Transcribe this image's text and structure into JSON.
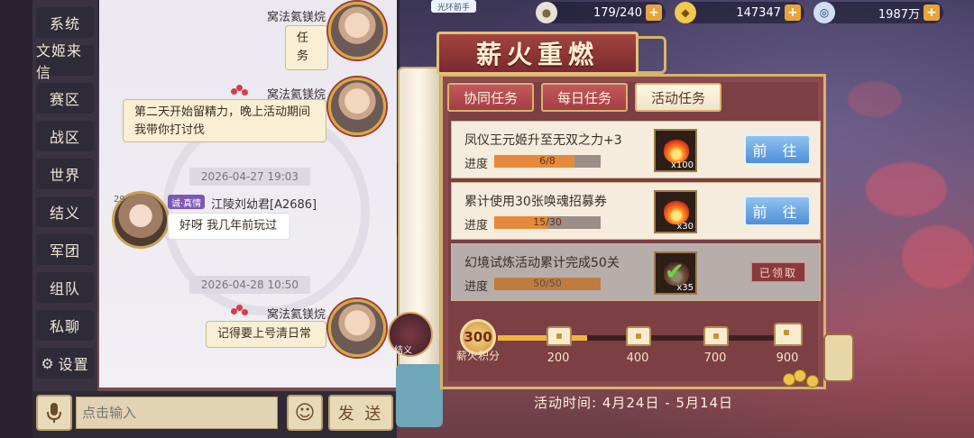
{
  "resources": [
    {
      "icon": "bun-icon",
      "value": "179/240",
      "color": "#ffffff"
    },
    {
      "icon": "gold-ingot-icon",
      "value": "147347",
      "color": "#f2c94c"
    },
    {
      "icon": "copper-coin-icon",
      "value": "1987万",
      "color": "#cfe0f3"
    }
  ],
  "top_badge": "光环前手",
  "sidebar": {
    "items": [
      "系统",
      "文姬来信",
      "赛区",
      "战区",
      "世界",
      "结义",
      "军团",
      "组队",
      "私聊"
    ],
    "settings": "设置"
  },
  "chat": {
    "messages": [
      {
        "type": "self",
        "name": "窝法氦镁烷",
        "text": "任务"
      },
      {
        "type": "self",
        "name": "窝法氦镁烷",
        "text": "第二天开始留精力，晚上活动期间我带你打讨伐"
      },
      {
        "type": "time",
        "text": "2026-04-27 19:03"
      },
      {
        "type": "other",
        "level": "29",
        "badge": "诚·真情",
        "name": "江陵刘幼君[A2686]",
        "text": "好呀 我几年前玩过"
      },
      {
        "type": "time",
        "text": "2026-04-28 10:50"
      },
      {
        "type": "self",
        "name": "窝法氦镁烷",
        "text": "记得要上号清日常"
      }
    ]
  },
  "input": {
    "placeholder": "点击输入",
    "send": "发 送"
  },
  "event": {
    "title": "薪火重燃",
    "tabs": [
      {
        "label": "协同任务",
        "active": false
      },
      {
        "label": "每日任务",
        "active": false
      },
      {
        "label": "活动任务",
        "active": true
      }
    ],
    "tasks": [
      {
        "desc": "凤仪王元姬升至无双之力+3",
        "progress_label": "进度",
        "progress_text": "6/8",
        "progress": 0.75,
        "reward_qty": "x100",
        "action": "前 往",
        "done": false
      },
      {
        "desc": "累计使用30张唤魂招募券",
        "progress_label": "进度",
        "progress_text": "15/30",
        "progress": 0.5,
        "reward_qty": "x30",
        "action": "前 往",
        "done": false
      },
      {
        "desc": "幻境试炼活动累计完成50关",
        "progress_label": "进度",
        "progress_text": "50/50",
        "progress": 1.0,
        "reward_qty": "x35",
        "action": "已领取",
        "done": true
      }
    ],
    "score": {
      "value": "300",
      "label": "薪火积分",
      "progress": 0.3
    },
    "milestones": [
      "200",
      "400",
      "700",
      "900"
    ],
    "activity_time": "活动时间: 4月24日 - 5月14日",
    "emblem_text": "结义"
  }
}
